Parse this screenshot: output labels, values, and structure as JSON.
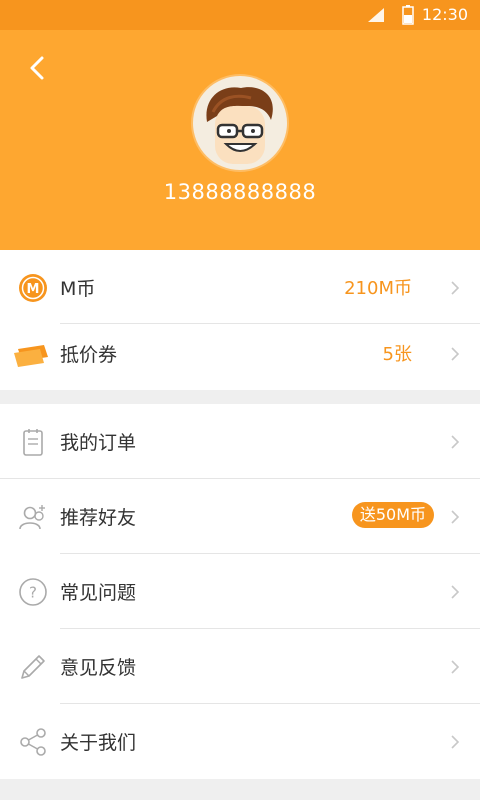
{
  "status_bar": {
    "time": "12:30",
    "icons": [
      "signal-icon",
      "battery-icon"
    ]
  },
  "header": {
    "back_icon": "back-arrow-icon",
    "avatar": "cartoon-avatar",
    "phone": "13888888888",
    "background_color": "#fea730"
  },
  "wallet": {
    "m_coin": {
      "label": "M币",
      "value": "210M币",
      "icon": "m-coin-icon"
    },
    "voucher": {
      "label": "抵价券",
      "value": "5张",
      "icon": "ticket-icon"
    }
  },
  "menu": {
    "orders": {
      "label": "我的订单",
      "icon": "clipboard-icon"
    },
    "invite": {
      "label": "推荐好友",
      "badge": "送50M币",
      "icon": "add-friend-icon"
    },
    "faq": {
      "label": "常见问题",
      "icon": "question-icon"
    },
    "feedback": {
      "label": "意见反馈",
      "icon": "pencil-icon"
    },
    "about": {
      "label": "关于我们",
      "icon": "share-icon"
    }
  },
  "colors": {
    "accent": "#f7951e",
    "text": "#333333",
    "divider": "#e5e5e5",
    "icon": "#aaaaaa"
  }
}
